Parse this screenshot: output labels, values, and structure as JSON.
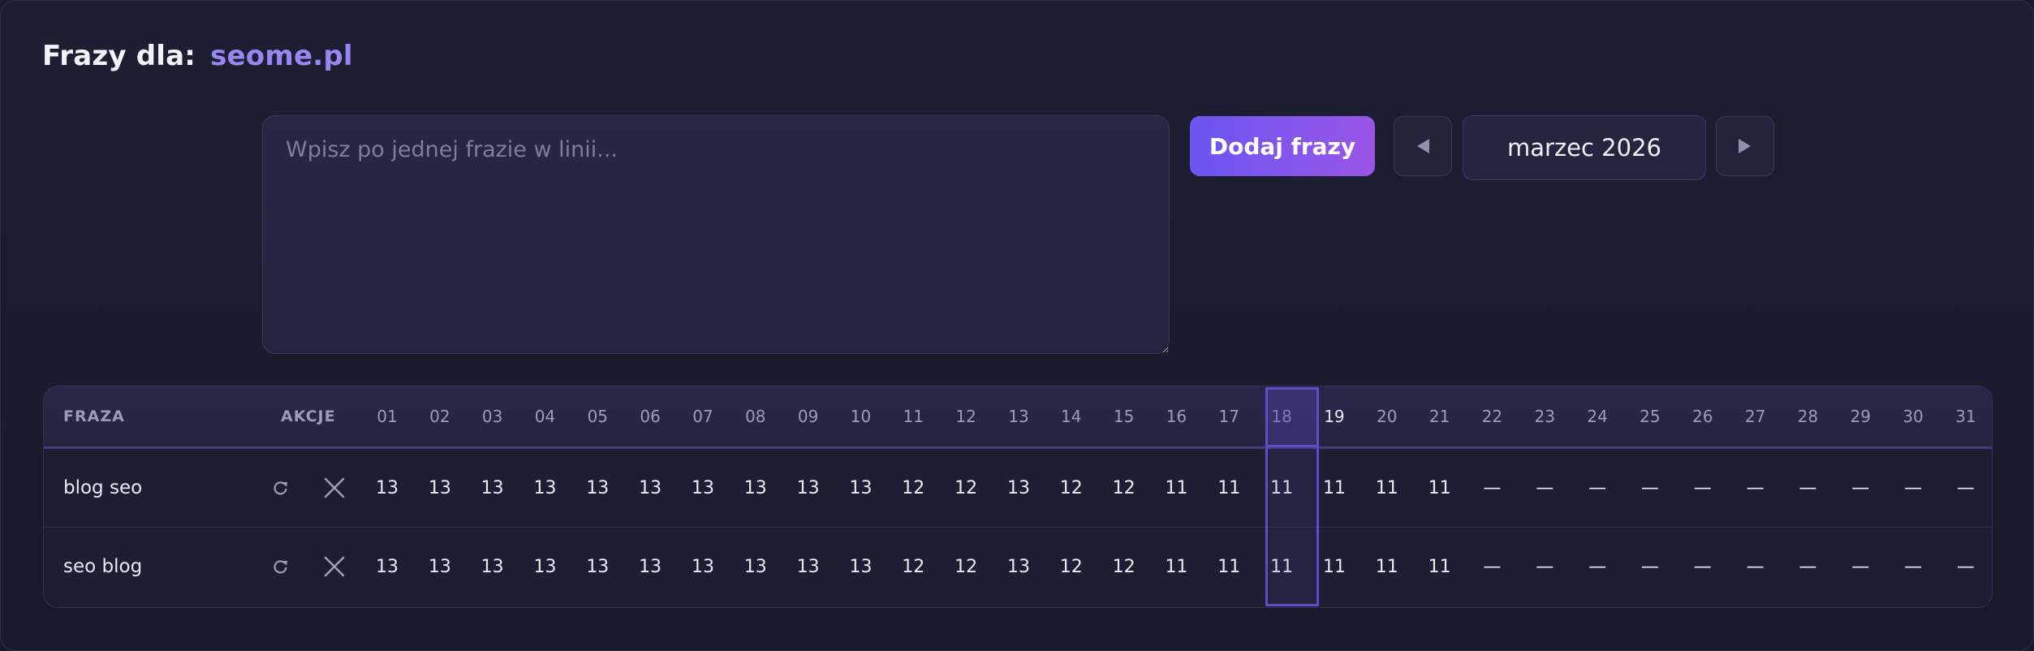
{
  "header": {
    "prefix": "Frazy dla:",
    "domain": "seome.pl"
  },
  "form": {
    "placeholder": "Wpisz po jednej frazie w linii...",
    "add_label": "Dodaj frazy",
    "month": "marzec 2026"
  },
  "colors": {
    "accent": "#6a55f0",
    "accent2": "#9a55e8",
    "domain": "#9a86f3",
    "today": "#5b4ec6"
  },
  "icons": {
    "prev": "triangle-left-icon",
    "next": "triangle-right-icon",
    "refresh": "refresh-icon",
    "delete": "close-icon"
  },
  "table": {
    "col_phrase": "FRAZA",
    "col_actions": "AKCJE",
    "days": [
      "01",
      "02",
      "03",
      "04",
      "05",
      "06",
      "07",
      "08",
      "09",
      "10",
      "11",
      "12",
      "13",
      "14",
      "15",
      "16",
      "17",
      "18",
      "19",
      "20",
      "21",
      "22",
      "23",
      "24",
      "25",
      "26",
      "27",
      "28",
      "29",
      "30",
      "31"
    ],
    "today_day": "19",
    "rows": [
      {
        "phrase": "blog seo",
        "values": [
          "13",
          "13",
          "13",
          "13",
          "13",
          "13",
          "13",
          "13",
          "13",
          "13",
          "12",
          "12",
          "13",
          "12",
          "12",
          "11",
          "11",
          "11",
          "11",
          "11",
          "11",
          "—",
          "—",
          "—",
          "—",
          "—",
          "—",
          "—",
          "—",
          "—",
          "—"
        ]
      },
      {
        "phrase": "seo blog",
        "values": [
          "13",
          "13",
          "13",
          "13",
          "13",
          "13",
          "13",
          "13",
          "13",
          "13",
          "12",
          "12",
          "13",
          "12",
          "12",
          "11",
          "11",
          "11",
          "11",
          "11",
          "11",
          "—",
          "—",
          "—",
          "—",
          "—",
          "—",
          "—",
          "—",
          "—",
          "—"
        ]
      }
    ]
  }
}
